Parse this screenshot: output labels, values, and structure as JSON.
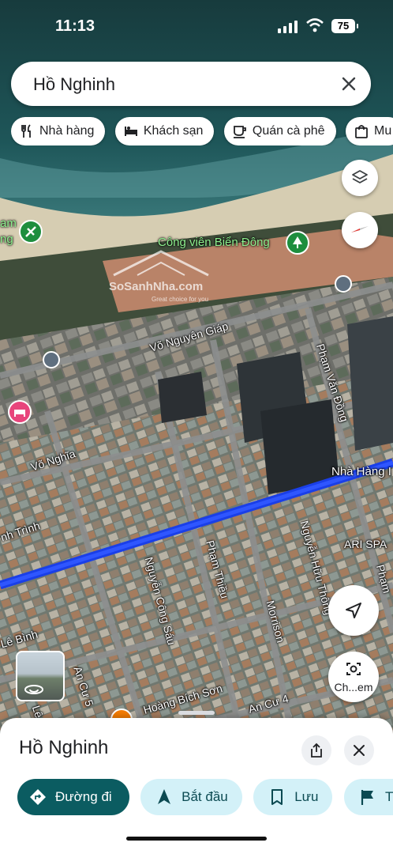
{
  "status_bar": {
    "time": "11:13",
    "battery": "75"
  },
  "search": {
    "query": "Hồ Nghinh"
  },
  "chips": [
    {
      "label": "Nhà hàng",
      "icon": "restaurant-icon"
    },
    {
      "label": "Khách sạn",
      "icon": "hotel-icon"
    },
    {
      "label": "Quán cà phê",
      "icon": "coffee-icon"
    },
    {
      "label": "Mu",
      "icon": "shopping-bag-icon"
    }
  ],
  "map_labels": {
    "park": "Công viên Biển Đông",
    "park_left_1": "am",
    "park_left_2": "ng",
    "road_vo_nguyen_giap": "Võ Nguyên Giáp",
    "road_pham_van_dong": "Phạm Văn Đồng",
    "road_vo_nghia": "Võ Nghĩa",
    "road_nha_hang": "Nhà Hàng I",
    "road_ari_spa": "ARI SPA",
    "road_nh_trinh": "nh Trình",
    "road_pham_thieu": "Phạm Thiều",
    "road_nguyen_cong_sau": "Nguyễn Công Sáu",
    "road_morrison": "Morrison",
    "road_nguyen_huu_thong": "Nguyễn Hữu Thông",
    "road_pham_right": "Phạm",
    "road_le_binh": "Lê Bình",
    "road_an_cu_5": "An Cư 5",
    "road_hoang_bich_son": "Hoàng Bích Sơn",
    "road_an_cu_4": "An Cư 4",
    "road_la": "Lê"
  },
  "watermark": {
    "brand": "SoSanhNha.com",
    "tagline": "Great choice for you"
  },
  "lens_button": {
    "label": "Ch...em"
  },
  "place": {
    "title": "Hồ Nghinh"
  },
  "actions": [
    {
      "label": "Đường đi",
      "icon": "directions-icon"
    },
    {
      "label": "Bắt đầu",
      "icon": "navigation-arrow-icon"
    },
    {
      "label": "Lưu",
      "icon": "bookmark-icon"
    },
    {
      "label": "Thê",
      "icon": "flag-icon"
    }
  ],
  "colors": {
    "route": "#1a3fe8",
    "primary_action": "#0b5c61",
    "secondary_action": "#d3f1f8",
    "park_pin": "#1e8e3e",
    "hotel_pin": "#e8457c"
  }
}
